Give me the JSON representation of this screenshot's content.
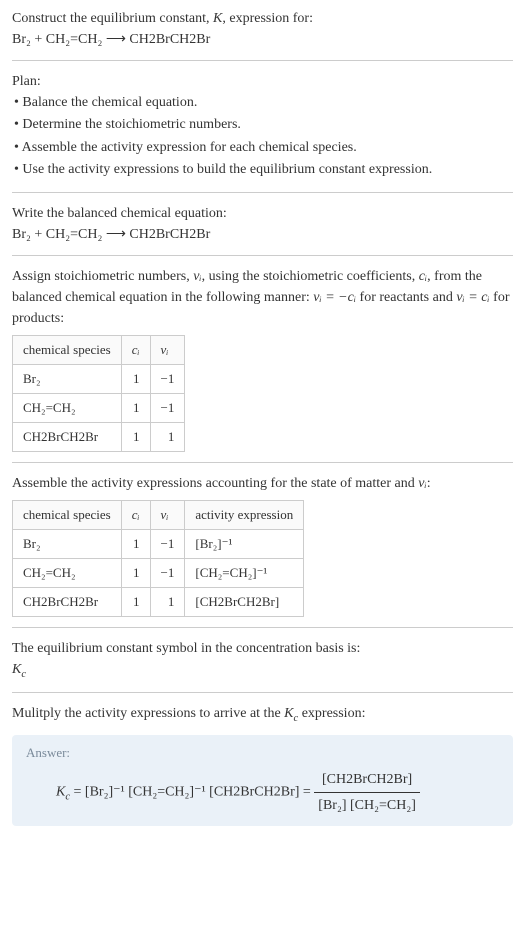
{
  "intro": {
    "line1_prefix": "Construct the equilibrium constant, ",
    "line1_K": "K",
    "line1_suffix": ", expression for:",
    "reaction": "Br₂ + CH₂=CH₂  ⟶  CH2BrCH2Br"
  },
  "plan": {
    "header": "Plan:",
    "items": [
      "Balance the chemical equation.",
      "Determine the stoichiometric numbers.",
      "Assemble the activity expression for each chemical species.",
      "Use the activity expressions to build the equilibrium constant expression."
    ]
  },
  "balanced": {
    "header": "Write the balanced chemical equation:",
    "reaction": "Br₂ + CH₂=CH₂  ⟶  CH2BrCH2Br"
  },
  "assign": {
    "text_prefix": "Assign stoichiometric numbers, ",
    "nu_i": "νᵢ",
    "text_mid1": ", using the stoichiometric coefficients, ",
    "c_i": "cᵢ",
    "text_mid2": ", from the balanced chemical equation in the following manner: ",
    "rule1": "νᵢ = −cᵢ",
    "text_mid3": " for reactants and ",
    "rule2": "νᵢ = cᵢ",
    "text_end": " for products:",
    "table_headers": [
      "chemical species",
      "cᵢ",
      "νᵢ"
    ],
    "table_rows": [
      [
        "Br₂",
        "1",
        "−1"
      ],
      [
        "CH₂=CH₂",
        "1",
        "−1"
      ],
      [
        "CH2BrCH2Br",
        "1",
        "1"
      ]
    ]
  },
  "assemble": {
    "text_prefix": "Assemble the activity expressions accounting for the state of matter and ",
    "nu_i": "νᵢ",
    "text_suffix": ":",
    "table_headers": [
      "chemical species",
      "cᵢ",
      "νᵢ",
      "activity expression"
    ],
    "table_rows": [
      [
        "Br₂",
        "1",
        "−1",
        "[Br₂]⁻¹"
      ],
      [
        "CH₂=CH₂",
        "1",
        "−1",
        "[CH₂=CH₂]⁻¹"
      ],
      [
        "CH2BrCH2Br",
        "1",
        "1",
        "[CH2BrCH2Br]"
      ]
    ]
  },
  "symbol": {
    "text": "The equilibrium constant symbol in the concentration basis is:",
    "Kc": "K",
    "Kc_sub": "c"
  },
  "multiply": {
    "text_prefix": "Mulitply the activity expressions to arrive at the ",
    "Kc": "K",
    "Kc_sub": "c",
    "text_suffix": " expression:"
  },
  "answer": {
    "label": "Answer:",
    "Kc": "K",
    "Kc_sub": "c",
    "eq": " = [Br₂]⁻¹ [CH₂=CH₂]⁻¹ [CH2BrCH2Br] = ",
    "frac_num": "[CH2BrCH2Br]",
    "frac_den": "[Br₂] [CH₂=CH₂]"
  }
}
